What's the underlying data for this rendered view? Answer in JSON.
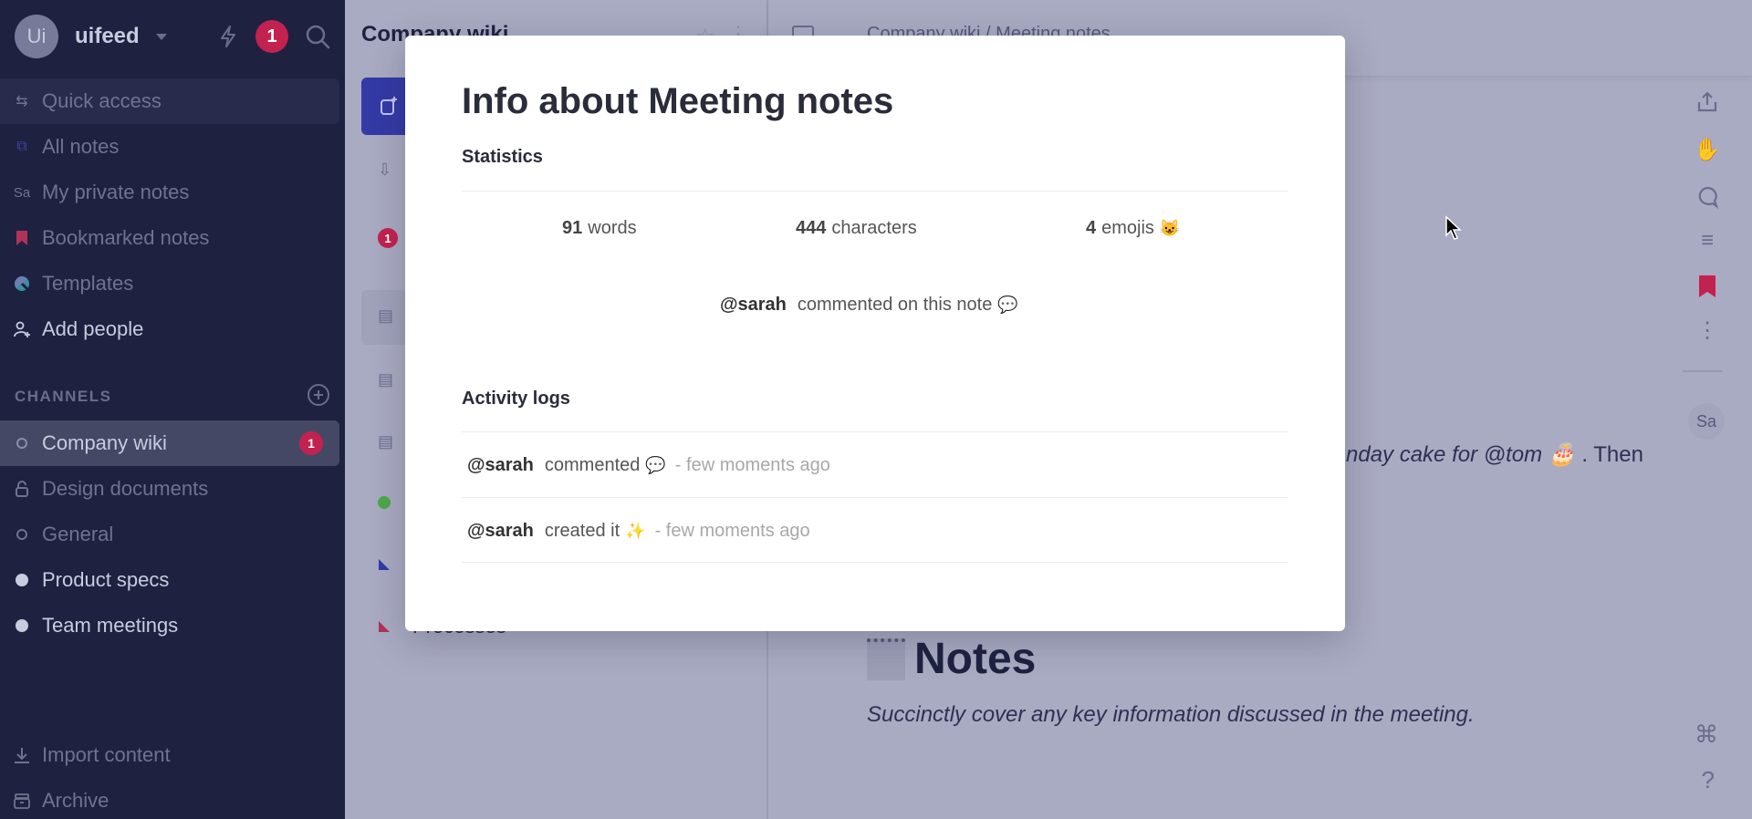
{
  "sidebar": {
    "workspace": {
      "avatar_initials": "Ui",
      "name": "uifeed"
    },
    "notification_count": "1",
    "nav": [
      {
        "label": "Quick access",
        "icon": "arrows-swap-icon"
      },
      {
        "label": "All notes",
        "icon": "notes-stack-icon"
      },
      {
        "label": "My private notes",
        "icon_text": "Sa"
      },
      {
        "label": "Bookmarked notes",
        "icon": "bookmark-icon"
      },
      {
        "label": "Templates",
        "icon": "templates-icon"
      },
      {
        "label": "Add people",
        "icon": "add-person-icon"
      }
    ],
    "channels_header": "CHANNELS",
    "channels": [
      {
        "label": "Company wiki",
        "badge": "1",
        "icon": "circle-outline-icon"
      },
      {
        "label": "Design documents",
        "icon": "lock-icon"
      },
      {
        "label": "General",
        "icon": "circle-outline-icon"
      },
      {
        "label": "Product specs",
        "icon": "circle-filled-icon"
      },
      {
        "label": "Team meetings",
        "icon": "circle-filled-icon"
      }
    ],
    "footer": [
      {
        "label": "Import content",
        "icon": "download-icon"
      },
      {
        "label": "Archive",
        "icon": "archive-icon"
      }
    ]
  },
  "middle": {
    "title": "Company wiki",
    "row_badge": "1",
    "visible_item": "Processes"
  },
  "editor": {
    "breadcrumb": [
      "Company wiki",
      "Meeting notes"
    ],
    "body_fragment": "nday cake for @tom",
    "body_fragment_emoji": "🎂",
    "body_fragment_tail": ". Then",
    "notes_heading": "Notes",
    "notes_emoji": "🗒️",
    "notes_subtitle": "Succinctly cover any key information discussed in the meeting.",
    "rail_avatar": "Sa"
  },
  "modal": {
    "title": "Info about Meeting notes",
    "statistics_label": "Statistics",
    "stats": [
      {
        "value": "91",
        "unit": "words"
      },
      {
        "value": "444",
        "unit": "characters"
      },
      {
        "value": "4",
        "unit": "emojis",
        "emoji": "😺"
      }
    ],
    "comment_summary": {
      "user": "@sarah",
      "text": "commented on this note",
      "emoji": "💬"
    },
    "activity_label": "Activity logs",
    "activity": [
      {
        "user": "@sarah",
        "action": "commented",
        "emoji": "💬",
        "time": "- few moments ago"
      },
      {
        "user": "@sarah",
        "action": "created it",
        "emoji": "✨",
        "time": "- few moments ago"
      }
    ]
  },
  "colors": {
    "sidebar_bg": "#1f2140",
    "accent_red": "#c2224f",
    "accent_blue": "#343aa6",
    "overlay_dim": "#a9abc2"
  }
}
